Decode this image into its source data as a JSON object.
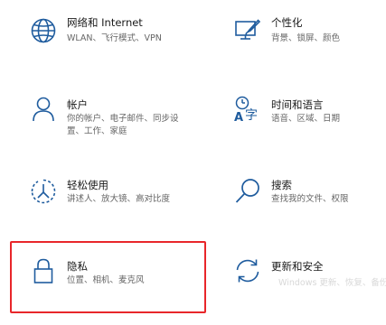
{
  "colors": {
    "icon_stroke": "#1f5c9e",
    "title": "#1a1a1a",
    "description": "#666666",
    "highlight_border": "#e8262a"
  },
  "tiles": [
    {
      "title": "网络和 Internet",
      "desc_lines": [
        "WLAN、飞行模式、VPN"
      ],
      "icon": "globe-icon"
    },
    {
      "title": "个性化",
      "desc_lines": [
        "背景、锁屏、颜色"
      ],
      "icon": "personalization-icon"
    },
    {
      "title": "帐户",
      "desc_lines": [
        "你的帐户、电子邮件、同步设",
        "置、工作、家庭"
      ],
      "icon": "person-icon"
    },
    {
      "title": "时间和语言",
      "desc_lines": [
        "语音、区域、日期"
      ],
      "icon": "time-language-icon"
    },
    {
      "title": "轻松使用",
      "desc_lines": [
        "讲述人、放大镜、高对比度"
      ],
      "icon": "ease-of-access-icon"
    },
    {
      "title": "搜索",
      "desc_lines": [
        "查找我的文件、权限"
      ],
      "icon": "search-icon"
    },
    {
      "title": "隐私",
      "desc_lines": [
        "位置、相机、麦克风"
      ],
      "icon": "lock-icon"
    },
    {
      "title": "更新和安全",
      "desc_lines": [],
      "icon": "update-sync-icon"
    }
  ],
  "icon_glyphs": {
    "time_language_letter": "A",
    "time_language_char": "字"
  },
  "watermark_text": "Windows 更新、恢复、备份"
}
